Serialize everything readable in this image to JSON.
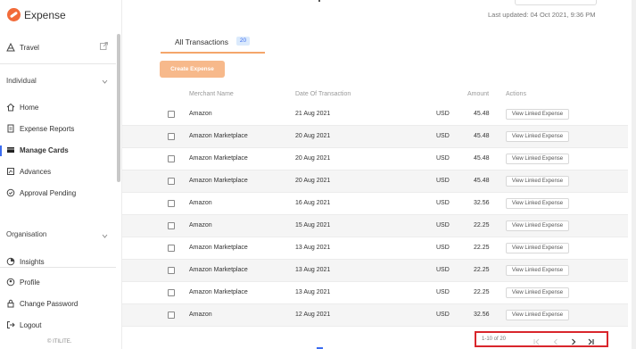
{
  "app": {
    "name": "Expense",
    "footer": "© ITILITE."
  },
  "sidebar": {
    "travel": "Travel",
    "individual_label": "Individual",
    "individual_items": [
      {
        "label": "Home",
        "icon": "home-icon"
      },
      {
        "label": "Expense Reports",
        "icon": "report-icon"
      },
      {
        "label": "Manage Cards",
        "icon": "card-icon",
        "active": true
      },
      {
        "label": "Advances",
        "icon": "advance-icon"
      },
      {
        "label": "Approval Pending",
        "icon": "clock-check-icon"
      }
    ],
    "organisation_label": "Organisation",
    "organisation_items": [
      {
        "label": "Insights",
        "icon": "insights-icon"
      }
    ],
    "bottom_items": [
      {
        "label": "Profile",
        "icon": "user-icon"
      },
      {
        "label": "Change Password",
        "icon": "lock-icon"
      },
      {
        "label": "Logout",
        "icon": "logout-icon"
      }
    ]
  },
  "header": {
    "last_updated": "Last updated: 04 Oct 2021, 9:36 PM"
  },
  "tabs": [
    {
      "label": "All Transactions",
      "count": "20"
    }
  ],
  "create_button": "Create Expense",
  "table": {
    "columns": [
      "Merchant Name",
      "Date Of Transaction",
      "Amount",
      "Actions"
    ],
    "rows": [
      {
        "merchant": "Amazon",
        "date": "21 Aug 2021",
        "currency": "USD",
        "amount": "45.48",
        "action": "View Linked Expense"
      },
      {
        "merchant": "Amazon Marketplace",
        "date": "20 Aug 2021",
        "currency": "USD",
        "amount": "45.48",
        "action": "View Linked Expense"
      },
      {
        "merchant": "Amazon Marketplace",
        "date": "20 Aug 2021",
        "currency": "USD",
        "amount": "45.48",
        "action": "View Linked Expense"
      },
      {
        "merchant": "Amazon Marketplace",
        "date": "20 Aug 2021",
        "currency": "USD",
        "amount": "45.48",
        "action": "View Linked Expense"
      },
      {
        "merchant": "Amazon",
        "date": "16 Aug 2021",
        "currency": "USD",
        "amount": "32.56",
        "action": "View Linked Expense"
      },
      {
        "merchant": "Amazon",
        "date": "15 Aug 2021",
        "currency": "USD",
        "amount": "22.25",
        "action": "View Linked Expense"
      },
      {
        "merchant": "Amazon Marketplace",
        "date": "13 Aug 2021",
        "currency": "USD",
        "amount": "22.25",
        "action": "View Linked Expense"
      },
      {
        "merchant": "Amazon Marketplace",
        "date": "13 Aug 2021",
        "currency": "USD",
        "amount": "22.25",
        "action": "View Linked Expense"
      },
      {
        "merchant": "Amazon Marketplace",
        "date": "13 Aug 2021",
        "currency": "USD",
        "amount": "22.25",
        "action": "View Linked Expense"
      },
      {
        "merchant": "Amazon",
        "date": "12 Aug 2021",
        "currency": "USD",
        "amount": "32.56",
        "action": "View Linked Expense"
      }
    ]
  },
  "pagination": {
    "text": "1-10 of 20"
  },
  "colors": {
    "brand": "#f26b3a",
    "accent": "#3b6cf0",
    "button": "#f7b98b",
    "highlight": "#d9262c"
  }
}
